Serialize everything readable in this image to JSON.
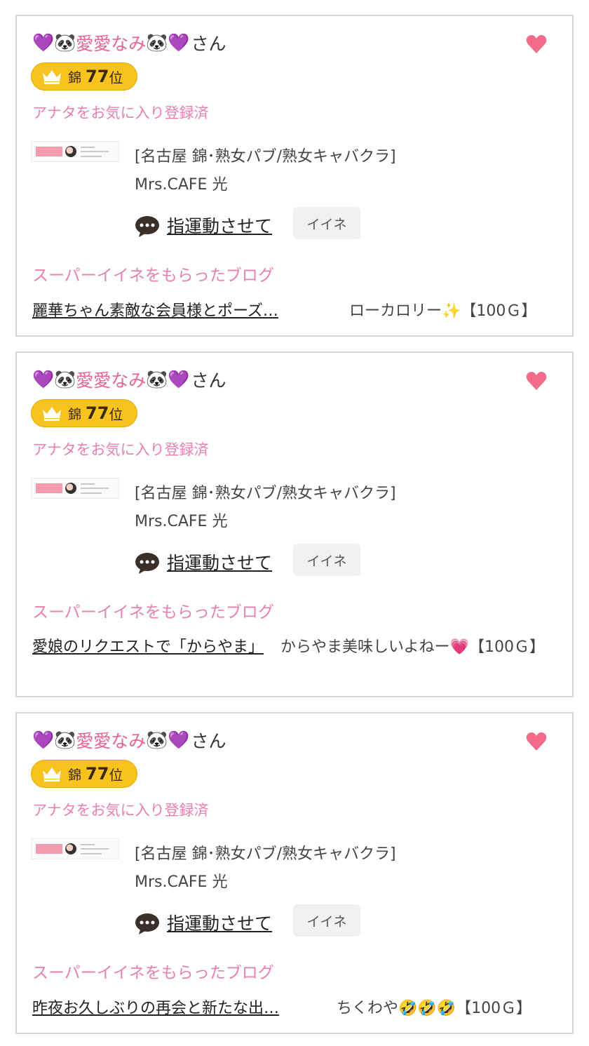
{
  "cards": [
    {
      "user": {
        "prefix_emoji": "💜🐼",
        "name": "愛愛なみ",
        "suffix_emoji": "🐼💜",
        "honorific": "さん"
      },
      "rank": {
        "area": "錦",
        "number": "77",
        "suffix": "位"
      },
      "fav_status": "アナタをお気に入り登録済",
      "shop": {
        "category": "[名古屋 錦･熟女パブ/熟女キャバクラ]",
        "name": "Mrs.CAFE 光"
      },
      "message_link": "指運動させて",
      "iine_label": "イイネ",
      "super_label": "スーパーイイネをもらったブログ",
      "blog": {
        "title": "麗華ちゃん素敵な会員様とポーズ…",
        "comment": "ローカロリー✨【100Ｇ】"
      }
    },
    {
      "user": {
        "prefix_emoji": "💜🐼",
        "name": "愛愛なみ",
        "suffix_emoji": "🐼💜",
        "honorific": "さん"
      },
      "rank": {
        "area": "錦",
        "number": "77",
        "suffix": "位"
      },
      "fav_status": "アナタをお気に入り登録済",
      "shop": {
        "category": "[名古屋 錦･熟女パブ/熟女キャバクラ]",
        "name": "Mrs.CAFE 光"
      },
      "message_link": "指運動させて",
      "iine_label": "イイネ",
      "super_label": "スーパーイイネをもらったブログ",
      "blog": {
        "title": "愛娘のリクエストで「からやま」",
        "comment": "からやま美味しいよねー💗【100Ｇ】"
      }
    },
    {
      "user": {
        "prefix_emoji": "💜🐼",
        "name": "愛愛なみ",
        "suffix_emoji": "🐼💜",
        "honorific": "さん"
      },
      "rank": {
        "area": "錦",
        "number": "77",
        "suffix": "位"
      },
      "fav_status": "アナタをお気に入り登録済",
      "shop": {
        "category": "[名古屋 錦･熟女パブ/熟女キャバクラ]",
        "name": "Mrs.CAFE 光"
      },
      "message_link": "指運動させて",
      "iine_label": "イイネ",
      "super_label": "スーパーイイネをもらったブログ",
      "blog": {
        "title": "昨夜お久しぶりの再会と新たな出…",
        "comment": "ちくわや🤣🤣🤣【100Ｇ】"
      }
    }
  ],
  "icons": {
    "favorite": "heart-icon",
    "rank": "crown-icon",
    "message": "speech-bubble-icon"
  },
  "colors": {
    "accent_pink": "#e880b0",
    "heart": "#f26b8a",
    "rank_gold": "#f8c21f",
    "border": "#d8d8d8"
  }
}
